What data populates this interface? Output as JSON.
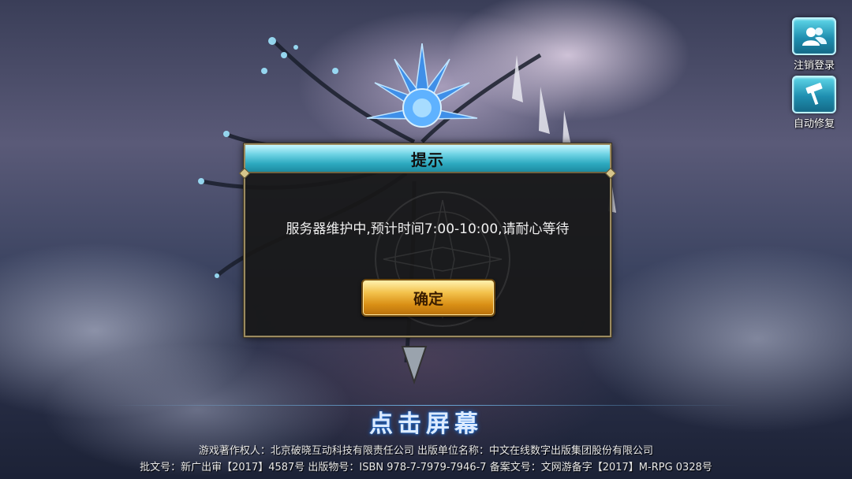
{
  "side_buttons": {
    "logout": {
      "label": "注销登录",
      "icon": "users-icon"
    },
    "repair": {
      "label": "自动修复",
      "icon": "hammer-icon"
    }
  },
  "dialog": {
    "title": "提示",
    "message": "服务器维护中,预计时间7:00-10:00,请耐心等待",
    "confirm_label": "确定"
  },
  "tap_prompt": "点击屏幕",
  "footer": {
    "line1": "游戏著作权人：北京破晓互动科技有限责任公司  出版单位名称：中文在线数字出版集团股份有限公司",
    "line2": "批文号：新广出审【2017】4587号  出版物号：ISBN 978-7-7979-7946-7  备案文号：文网游备字【2017】M-RPG 0328号"
  },
  "colors": {
    "dialog_title_accent": "#2da9bf",
    "confirm_button": "#f3c24c",
    "side_button": "#1f8fb0"
  }
}
